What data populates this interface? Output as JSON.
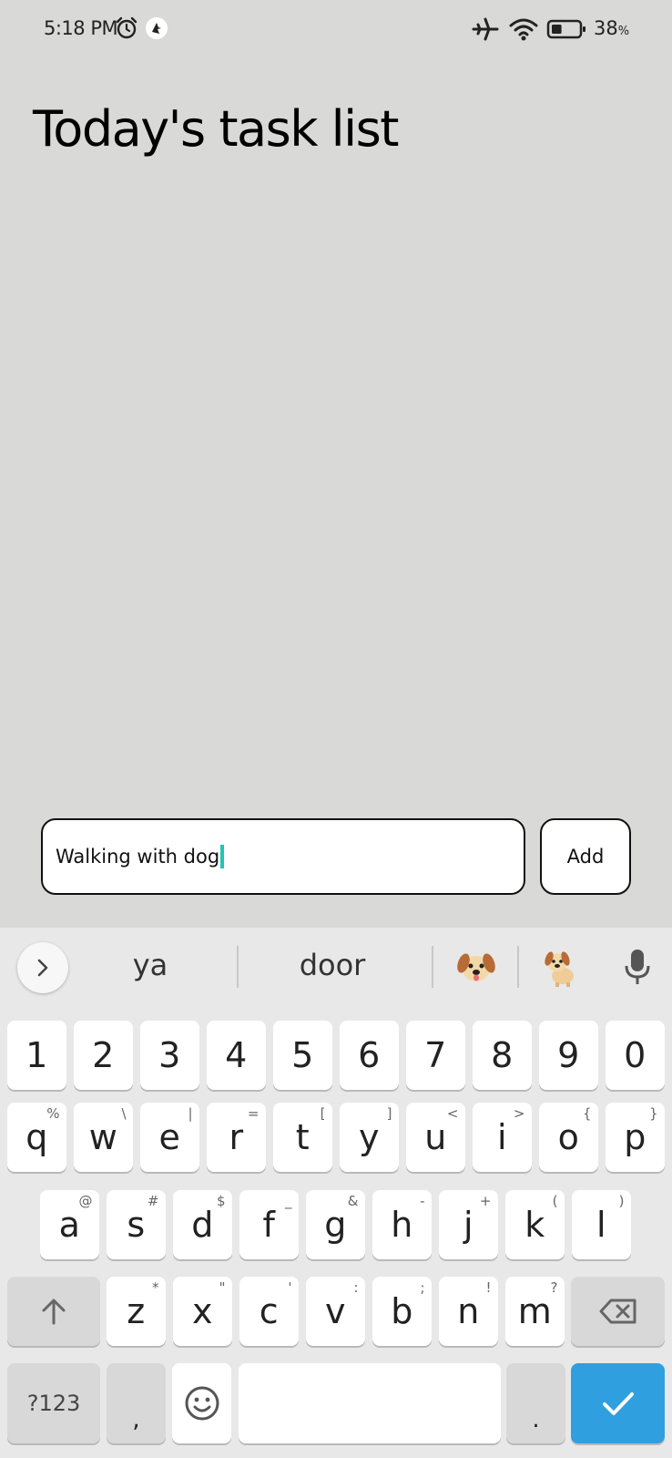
{
  "status_bar": {
    "time": "5:18 PM",
    "battery_pct": "38",
    "battery_unit": "%",
    "battery_level": 0.38,
    "icons": [
      "alarm-icon",
      "app-notification-icon",
      "airplane-mode-icon",
      "wifi-icon",
      "battery-icon"
    ]
  },
  "page": {
    "title": "Today's task list"
  },
  "task_input": {
    "value": "Walking with dog"
  },
  "add_button": {
    "label": "Add"
  },
  "keyboard": {
    "suggestions": [
      "ya",
      "door"
    ],
    "suggestion_emojis": [
      "dog-face-emoji",
      "dog-emoji"
    ],
    "number_row": [
      "1",
      "2",
      "3",
      "4",
      "5",
      "6",
      "7",
      "8",
      "9",
      "0"
    ],
    "row1": [
      {
        "key": "q",
        "alt": "%"
      },
      {
        "key": "w",
        "alt": "\\"
      },
      {
        "key": "e",
        "alt": "|"
      },
      {
        "key": "r",
        "alt": "="
      },
      {
        "key": "t",
        "alt": "["
      },
      {
        "key": "y",
        "alt": "]"
      },
      {
        "key": "u",
        "alt": "<"
      },
      {
        "key": "i",
        "alt": ">"
      },
      {
        "key": "o",
        "alt": "{"
      },
      {
        "key": "p",
        "alt": "}"
      }
    ],
    "row2": [
      {
        "key": "a",
        "alt": "@"
      },
      {
        "key": "s",
        "alt": "#"
      },
      {
        "key": "d",
        "alt": "$"
      },
      {
        "key": "f",
        "alt": "_"
      },
      {
        "key": "g",
        "alt": "&"
      },
      {
        "key": "h",
        "alt": "-"
      },
      {
        "key": "j",
        "alt": "+"
      },
      {
        "key": "k",
        "alt": "("
      },
      {
        "key": "l",
        "alt": ")"
      }
    ],
    "row3": [
      {
        "key": "z",
        "alt": "*"
      },
      {
        "key": "x",
        "alt": "\""
      },
      {
        "key": "c",
        "alt": "'"
      },
      {
        "key": "v",
        "alt": ":"
      },
      {
        "key": "b",
        "alt": ";"
      },
      {
        "key": "n",
        "alt": "!"
      },
      {
        "key": "m",
        "alt": "?"
      }
    ],
    "symbols_label": "?123",
    "comma_label": ",",
    "period_label": ".",
    "accent_color": "#2f9fe0"
  }
}
